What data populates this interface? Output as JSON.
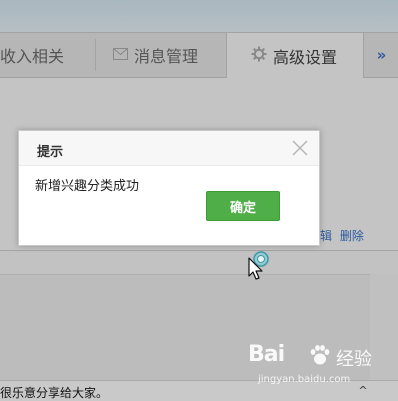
{
  "tabs": [
    {
      "label": "收入相关",
      "icon": "none"
    },
    {
      "label": "消息管理",
      "icon": "mail-icon"
    },
    {
      "label": "高级设置",
      "icon": "gear-icon",
      "active": true
    },
    {
      "label": "»",
      "icon": "double-chevron-right-icon"
    }
  ],
  "row_actions": {
    "edit_partial": "辑",
    "delete": "删除"
  },
  "bottom_text": "很乐意分享给大家。",
  "dialog": {
    "title": "提示",
    "message": "新增兴趣分类成功",
    "ok_label": "确定",
    "close_icon": "close-icon"
  },
  "colors": {
    "ok_button": "#4fae48",
    "link": "#2b5b9e",
    "overlay": "#c2c2c2"
  },
  "watermark": {
    "brand": "Bai",
    "brand_cn": "经验",
    "url": "jingyan.baidu.com"
  }
}
